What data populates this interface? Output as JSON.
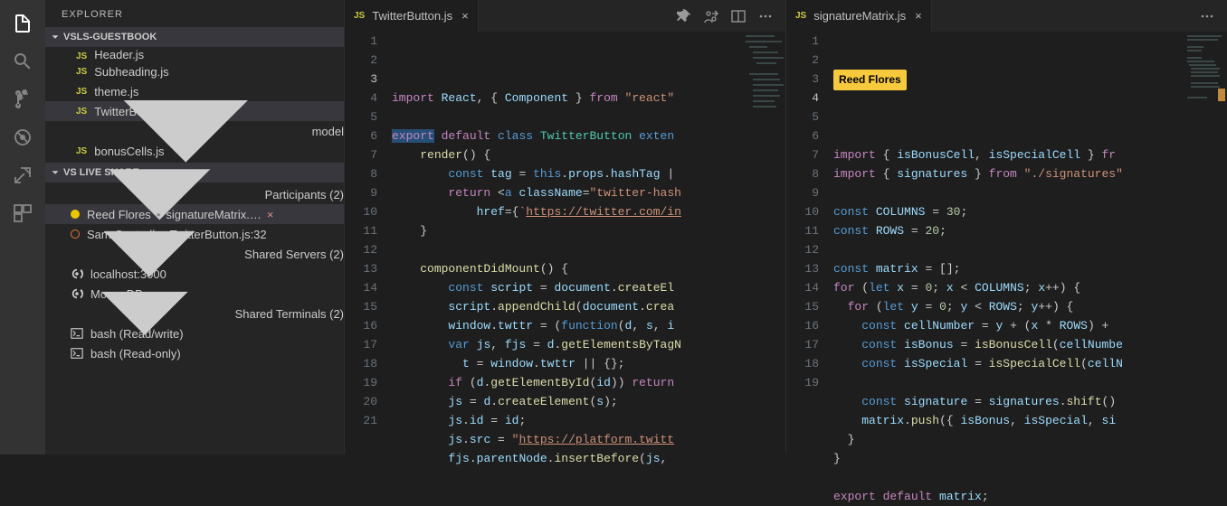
{
  "explorer": {
    "title": "EXPLORER",
    "sections": {
      "guestbook": {
        "label": "VSLS-GUESTBOOK",
        "files": [
          {
            "name": "Header.js",
            "partial": true
          },
          {
            "name": "Subheading.js"
          },
          {
            "name": "theme.js"
          },
          {
            "name": "TwitterButton.js",
            "selected": true
          }
        ],
        "folder": {
          "name": "model"
        },
        "folder_files": [
          {
            "name": "bonusCells.js"
          }
        ]
      },
      "liveshare": {
        "label": "VS LIVE SHARE",
        "participants_label": "Participants (2)",
        "p1_name": "Reed Flores",
        "p1_file": "signatureMatrix.…",
        "p2_name": "Sam Cantrell",
        "p2_file": "TwitterButton.js:32",
        "servers_label": "Shared Servers (2)",
        "server1": "localhost:3000",
        "server2": "MongoDB",
        "terminals_label": "Shared Terminals (2)",
        "terminal1": "bash (Read/write)",
        "terminal2": "bash (Read-only)"
      }
    }
  },
  "editor1": {
    "tab": "TwitterButton.js",
    "lines": [
      {
        "n": 1,
        "tokens": [
          {
            "c": "k-purple",
            "t": "import"
          },
          {
            "t": " "
          },
          {
            "c": "k-var",
            "t": "React"
          },
          {
            "t": ", { "
          },
          {
            "c": "k-var",
            "t": "Component"
          },
          {
            "t": " } "
          },
          {
            "c": "k-purple",
            "t": "from"
          },
          {
            "t": " "
          },
          {
            "c": "k-str",
            "t": "\"react\""
          }
        ]
      },
      {
        "n": 2,
        "tokens": []
      },
      {
        "n": 3,
        "cur": true,
        "tokens": [
          {
            "sel": true,
            "c": "k-purple",
            "t": "export"
          },
          {
            "t": " "
          },
          {
            "c": "k-purple",
            "t": "default"
          },
          {
            "t": " "
          },
          {
            "c": "k-blue",
            "t": "class"
          },
          {
            "t": " "
          },
          {
            "c": "k-type",
            "t": "TwitterButton"
          },
          {
            "t": " "
          },
          {
            "c": "k-blue",
            "t": "exten"
          }
        ]
      },
      {
        "n": 4,
        "tokens": [
          {
            "t": "    "
          },
          {
            "c": "k-yellow",
            "t": "render"
          },
          {
            "t": "() {"
          }
        ]
      },
      {
        "n": 5,
        "tokens": [
          {
            "t": "        "
          },
          {
            "c": "k-blue",
            "t": "const"
          },
          {
            "t": " "
          },
          {
            "c": "k-var",
            "t": "tag"
          },
          {
            "t": " = "
          },
          {
            "c": "k-blue",
            "t": "this"
          },
          {
            "t": "."
          },
          {
            "c": "k-var",
            "t": "props"
          },
          {
            "t": "."
          },
          {
            "c": "k-var",
            "t": "hashTag"
          },
          {
            "t": " |"
          }
        ]
      },
      {
        "n": 6,
        "tokens": [
          {
            "t": "        "
          },
          {
            "c": "k-purple",
            "t": "return"
          },
          {
            "t": " <"
          },
          {
            "c": "k-blue",
            "t": "a"
          },
          {
            "t": " "
          },
          {
            "c": "k-var",
            "t": "className"
          },
          {
            "t": "="
          },
          {
            "c": "k-str",
            "t": "\"twitter-hash"
          }
        ]
      },
      {
        "n": 7,
        "tokens": [
          {
            "t": "            "
          },
          {
            "c": "k-var",
            "t": "href"
          },
          {
            "t": "={"
          },
          {
            "c": "k-str",
            "t": "`"
          },
          {
            "c": "k-str",
            "u": true,
            "t": "https://twitter.com/in"
          }
        ]
      },
      {
        "n": 8,
        "tokens": [
          {
            "t": "    }"
          }
        ]
      },
      {
        "n": 9,
        "tokens": []
      },
      {
        "n": 10,
        "tokens": [
          {
            "t": "    "
          },
          {
            "c": "k-yellow",
            "t": "componentDidMount"
          },
          {
            "t": "() {"
          }
        ]
      },
      {
        "n": 11,
        "tokens": [
          {
            "t": "        "
          },
          {
            "c": "k-blue",
            "t": "const"
          },
          {
            "t": " "
          },
          {
            "c": "k-var",
            "t": "script"
          },
          {
            "t": " = "
          },
          {
            "c": "k-var",
            "t": "document"
          },
          {
            "t": "."
          },
          {
            "c": "k-yellow",
            "t": "createEl"
          }
        ]
      },
      {
        "n": 12,
        "tokens": [
          {
            "t": "        "
          },
          {
            "c": "k-var",
            "t": "script"
          },
          {
            "t": "."
          },
          {
            "c": "k-yellow",
            "t": "appendChild"
          },
          {
            "t": "("
          },
          {
            "c": "k-var",
            "t": "document"
          },
          {
            "t": "."
          },
          {
            "c": "k-yellow",
            "t": "crea"
          }
        ]
      },
      {
        "n": 13,
        "tokens": [
          {
            "t": "        "
          },
          {
            "c": "k-var",
            "t": "window"
          },
          {
            "t": "."
          },
          {
            "c": "k-var",
            "t": "twttr"
          },
          {
            "t": " = ("
          },
          {
            "c": "k-blue",
            "t": "function"
          },
          {
            "t": "("
          },
          {
            "c": "k-var",
            "t": "d"
          },
          {
            "t": ", "
          },
          {
            "c": "k-var",
            "t": "s"
          },
          {
            "t": ", "
          },
          {
            "c": "k-var",
            "t": "i"
          }
        ]
      },
      {
        "n": 14,
        "tokens": [
          {
            "t": "        "
          },
          {
            "c": "k-blue",
            "t": "var"
          },
          {
            "t": " "
          },
          {
            "c": "k-var",
            "t": "js"
          },
          {
            "t": ", "
          },
          {
            "c": "k-var",
            "t": "fjs"
          },
          {
            "t": " = "
          },
          {
            "c": "k-var",
            "t": "d"
          },
          {
            "t": "."
          },
          {
            "c": "k-yellow",
            "t": "getElementsByTagN"
          }
        ]
      },
      {
        "n": 15,
        "tokens": [
          {
            "t": "          "
          },
          {
            "c": "k-var",
            "t": "t"
          },
          {
            "t": " = "
          },
          {
            "c": "k-var",
            "t": "window"
          },
          {
            "t": "."
          },
          {
            "c": "k-var",
            "t": "twttr"
          },
          {
            "t": " || {};"
          }
        ]
      },
      {
        "n": 16,
        "tokens": [
          {
            "t": "        "
          },
          {
            "c": "k-purple",
            "t": "if"
          },
          {
            "t": " ("
          },
          {
            "c": "k-var",
            "t": "d"
          },
          {
            "t": "."
          },
          {
            "c": "k-yellow",
            "t": "getElementById"
          },
          {
            "t": "("
          },
          {
            "c": "k-var",
            "t": "id"
          },
          {
            "t": ")) "
          },
          {
            "c": "k-purple",
            "t": "return"
          }
        ]
      },
      {
        "n": 17,
        "tokens": [
          {
            "t": "        "
          },
          {
            "c": "k-var",
            "t": "js"
          },
          {
            "t": " = "
          },
          {
            "c": "k-var",
            "t": "d"
          },
          {
            "t": "."
          },
          {
            "c": "k-yellow",
            "t": "createElement"
          },
          {
            "t": "("
          },
          {
            "c": "k-var",
            "t": "s"
          },
          {
            "t": ");"
          }
        ]
      },
      {
        "n": 18,
        "tokens": [
          {
            "t": "        "
          },
          {
            "c": "k-var",
            "t": "js"
          },
          {
            "t": "."
          },
          {
            "c": "k-var",
            "t": "id"
          },
          {
            "t": " = "
          },
          {
            "c": "k-var",
            "t": "id"
          },
          {
            "t": ";"
          }
        ]
      },
      {
        "n": 19,
        "tokens": [
          {
            "t": "        "
          },
          {
            "c": "k-var",
            "t": "js"
          },
          {
            "t": "."
          },
          {
            "c": "k-var",
            "t": "src"
          },
          {
            "t": " = "
          },
          {
            "c": "k-str",
            "t": "\""
          },
          {
            "c": "k-str",
            "u": true,
            "t": "https://platform.twitt"
          }
        ]
      },
      {
        "n": 20,
        "tokens": [
          {
            "t": "        "
          },
          {
            "c": "k-var",
            "t": "fjs"
          },
          {
            "t": "."
          },
          {
            "c": "k-var",
            "t": "parentNode"
          },
          {
            "t": "."
          },
          {
            "c": "k-yellow",
            "t": "insertBefore"
          },
          {
            "t": "("
          },
          {
            "c": "k-var",
            "t": "js"
          },
          {
            "t": ", "
          }
        ]
      },
      {
        "n": 21,
        "tokens": []
      }
    ]
  },
  "editor2": {
    "tab": "signatureMatrix.js",
    "user_label": "Reed Flores",
    "lines": [
      {
        "n": 1,
        "tokens": [
          {
            "c": "k-purple",
            "t": "import"
          },
          {
            "t": " { "
          },
          {
            "c": "k-var",
            "t": "isBonusCell"
          },
          {
            "t": ", "
          },
          {
            "c": "k-var",
            "t": "isSpecialCell"
          },
          {
            "t": " } "
          },
          {
            "c": "k-purple",
            "t": "fr"
          }
        ]
      },
      {
        "n": 2,
        "tokens": [
          {
            "c": "k-purple",
            "t": "import"
          },
          {
            "t": " { "
          },
          {
            "c": "k-var",
            "t": "signatures"
          },
          {
            "t": " } "
          },
          {
            "c": "k-purple",
            "t": "from"
          },
          {
            "t": " "
          },
          {
            "c": "k-str",
            "t": "\"./signatures\""
          }
        ]
      },
      {
        "n": 3,
        "tokens": []
      },
      {
        "n": 4,
        "cur": true,
        "tokens": [
          {
            "c": "k-blue",
            "t": "const"
          },
          {
            "t": " "
          },
          {
            "c": "k-var",
            "t": "COLUMNS"
          },
          {
            "t": " = "
          },
          {
            "c": "k-num",
            "t": "30"
          },
          {
            "t": ";"
          }
        ]
      },
      {
        "n": 5,
        "tokens": [
          {
            "c": "k-blue",
            "t": "const"
          },
          {
            "t": " "
          },
          {
            "c": "k-var",
            "t": "ROWS"
          },
          {
            "t": " = "
          },
          {
            "c": "k-num",
            "t": "20"
          },
          {
            "t": ";"
          }
        ]
      },
      {
        "n": 6,
        "tokens": []
      },
      {
        "n": 7,
        "tokens": [
          {
            "c": "k-blue",
            "t": "const"
          },
          {
            "t": " "
          },
          {
            "c": "k-var",
            "t": "matrix"
          },
          {
            "t": " = [];"
          }
        ]
      },
      {
        "n": 8,
        "tokens": [
          {
            "c": "k-purple",
            "t": "for"
          },
          {
            "t": " ("
          },
          {
            "c": "k-blue",
            "t": "let"
          },
          {
            "t": " "
          },
          {
            "c": "k-var",
            "t": "x"
          },
          {
            "t": " = "
          },
          {
            "c": "k-num",
            "t": "0"
          },
          {
            "t": "; "
          },
          {
            "c": "k-var",
            "t": "x"
          },
          {
            "t": " < "
          },
          {
            "c": "k-var",
            "t": "COLUMNS"
          },
          {
            "t": "; "
          },
          {
            "c": "k-var",
            "t": "x"
          },
          {
            "t": "++) {"
          }
        ]
      },
      {
        "n": 9,
        "tokens": [
          {
            "t": "  "
          },
          {
            "c": "k-purple",
            "t": "for"
          },
          {
            "t": " ("
          },
          {
            "c": "k-blue",
            "t": "let"
          },
          {
            "t": " "
          },
          {
            "c": "k-var",
            "t": "y"
          },
          {
            "t": " = "
          },
          {
            "c": "k-num",
            "t": "0"
          },
          {
            "t": "; "
          },
          {
            "c": "k-var",
            "t": "y"
          },
          {
            "t": " < "
          },
          {
            "c": "k-var",
            "t": "ROWS"
          },
          {
            "t": "; "
          },
          {
            "c": "k-var",
            "t": "y"
          },
          {
            "t": "++) {"
          }
        ]
      },
      {
        "n": 10,
        "tokens": [
          {
            "t": "    "
          },
          {
            "c": "k-blue",
            "t": "const"
          },
          {
            "t": " "
          },
          {
            "c": "k-var",
            "t": "cellNumber"
          },
          {
            "t": " = "
          },
          {
            "c": "k-var",
            "t": "y"
          },
          {
            "t": " + ("
          },
          {
            "c": "k-var",
            "t": "x"
          },
          {
            "t": " * "
          },
          {
            "c": "k-var",
            "t": "ROWS"
          },
          {
            "t": ") + "
          }
        ]
      },
      {
        "n": 11,
        "tokens": [
          {
            "t": "    "
          },
          {
            "c": "k-blue",
            "t": "const"
          },
          {
            "t": " "
          },
          {
            "c": "k-var",
            "t": "isBonus"
          },
          {
            "t": " = "
          },
          {
            "c": "k-yellow",
            "t": "isBonusCell"
          },
          {
            "t": "("
          },
          {
            "c": "k-var",
            "t": "cellNumbe"
          }
        ]
      },
      {
        "n": 12,
        "tokens": [
          {
            "t": "    "
          },
          {
            "c": "k-blue",
            "t": "const"
          },
          {
            "t": " "
          },
          {
            "c": "k-var",
            "t": "isSpecial"
          },
          {
            "t": " = "
          },
          {
            "c": "k-yellow",
            "t": "isSpecialCell"
          },
          {
            "t": "("
          },
          {
            "c": "k-var",
            "t": "cellN"
          }
        ]
      },
      {
        "n": 13,
        "tokens": []
      },
      {
        "n": 14,
        "tokens": [
          {
            "t": "    "
          },
          {
            "c": "k-blue",
            "t": "const"
          },
          {
            "t": " "
          },
          {
            "c": "k-var",
            "t": "signature"
          },
          {
            "t": " = "
          },
          {
            "c": "k-var",
            "t": "signatures"
          },
          {
            "t": "."
          },
          {
            "c": "k-yellow",
            "t": "shift"
          },
          {
            "t": "()"
          }
        ]
      },
      {
        "n": 15,
        "tokens": [
          {
            "t": "    "
          },
          {
            "c": "k-var",
            "t": "matrix"
          },
          {
            "t": "."
          },
          {
            "c": "k-yellow",
            "t": "push"
          },
          {
            "t": "({ "
          },
          {
            "c": "k-var",
            "t": "isBonus"
          },
          {
            "t": ", "
          },
          {
            "c": "k-var",
            "t": "isSpecial"
          },
          {
            "t": ", "
          },
          {
            "c": "k-var",
            "t": "si"
          }
        ]
      },
      {
        "n": 16,
        "tokens": [
          {
            "t": "  }"
          }
        ]
      },
      {
        "n": 17,
        "tokens": [
          {
            "t": "}"
          }
        ]
      },
      {
        "n": 18,
        "tokens": []
      },
      {
        "n": 19,
        "tokens": [
          {
            "c": "k-purple",
            "t": "export"
          },
          {
            "t": " "
          },
          {
            "c": "k-purple",
            "t": "default"
          },
          {
            "t": " "
          },
          {
            "c": "k-var",
            "t": "matrix"
          },
          {
            "t": ";"
          }
        ]
      }
    ]
  }
}
